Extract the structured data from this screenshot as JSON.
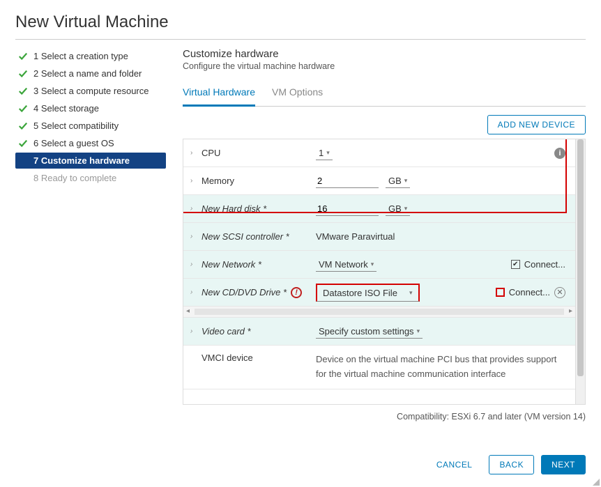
{
  "title": "New Virtual Machine",
  "steps": [
    {
      "label": "1 Select a creation type",
      "state": "done"
    },
    {
      "label": "2 Select a name and folder",
      "state": "done"
    },
    {
      "label": "3 Select a compute resource",
      "state": "done"
    },
    {
      "label": "4 Select storage",
      "state": "done"
    },
    {
      "label": "5 Select compatibility",
      "state": "done"
    },
    {
      "label": "6 Select a guest OS",
      "state": "done"
    },
    {
      "label": "7 Customize hardware",
      "state": "active"
    },
    {
      "label": "8 Ready to complete",
      "state": "pending"
    }
  ],
  "main": {
    "subtitle": "Customize hardware",
    "desc": "Configure the virtual machine hardware",
    "tabs": [
      {
        "label": "Virtual Hardware",
        "active": true
      },
      {
        "label": "VM Options",
        "active": false
      }
    ],
    "add_button": "ADD NEW DEVICE",
    "hardware": {
      "cpu": {
        "label": "CPU",
        "value": "1"
      },
      "memory": {
        "label": "Memory",
        "value": "2",
        "unit": "GB"
      },
      "disk": {
        "label": "New Hard disk *",
        "value": "16",
        "unit": "GB"
      },
      "scsi": {
        "label": "New SCSI controller *",
        "value": "VMware Paravirtual"
      },
      "network": {
        "label": "New Network *",
        "value": "VM Network",
        "connect": "Connect..."
      },
      "cddvd": {
        "label": "New CD/DVD Drive *",
        "value": "Datastore ISO File",
        "connect": "Connect..."
      },
      "video": {
        "label": "Video card *",
        "value": "Specify custom settings"
      },
      "vmci": {
        "label": "VMCI device",
        "value": "Device on the virtual machine PCI bus that provides support for the virtual machine communication interface"
      }
    },
    "compat": "Compatibility: ESXi 6.7 and later (VM version 14)"
  },
  "footer": {
    "cancel": "CANCEL",
    "back": "BACK",
    "next": "NEXT"
  }
}
